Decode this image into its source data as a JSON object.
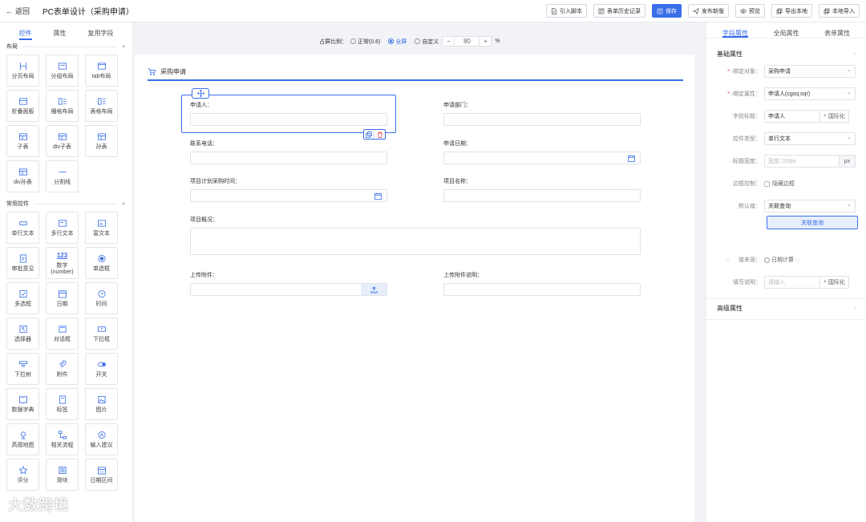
{
  "topbar": {
    "back_label": "返回",
    "title": "PC表单设计（采购申请）",
    "buttons": [
      {
        "label": "引入脚本",
        "icon": "script-icon",
        "primary": false
      },
      {
        "label": "表单历史记录",
        "icon": "history-icon",
        "primary": false
      },
      {
        "label": "保存",
        "icon": "save-icon",
        "primary": true
      },
      {
        "label": "发布新版",
        "icon": "send-icon",
        "primary": false
      },
      {
        "label": "预览",
        "icon": "eye-icon",
        "primary": false
      },
      {
        "label": "导出本地",
        "icon": "export-icon",
        "primary": false
      },
      {
        "label": "本地导入",
        "icon": "import-icon",
        "primary": false
      }
    ]
  },
  "left_panel": {
    "tabs": [
      "控件",
      "属性",
      "复用字段"
    ],
    "active_tab": 0,
    "layout_section": {
      "title": "布局",
      "items": [
        {
          "label": "分页布局",
          "icon": "page-layout-icon"
        },
        {
          "label": "分组布局",
          "icon": "tab-group-icon"
        },
        {
          "label": "tab布局",
          "icon": "tab-layout-icon"
        },
        {
          "label": "折叠面板",
          "icon": "collapse-icon"
        },
        {
          "label": "栅格布局",
          "icon": "grid-layout-icon"
        },
        {
          "label": "表格布局",
          "icon": "table-layout-icon"
        },
        {
          "label": "子表",
          "icon": "subtable-icon"
        },
        {
          "label": "div子表",
          "icon": "div-subtable-icon"
        },
        {
          "label": "孙表",
          "icon": "grandchild-table-icon"
        },
        {
          "label": "div孙表",
          "icon": "div-grandchild-icon"
        },
        {
          "label": "分割线",
          "icon": "divider-icon"
        }
      ]
    },
    "common_section": {
      "title": "常用控件",
      "items": [
        {
          "label": "单行文本",
          "icon": "single-line-icon"
        },
        {
          "label": "多行文本",
          "icon": "multi-line-icon"
        },
        {
          "label": "富文本",
          "icon": "rich-text-icon"
        },
        {
          "label": "审批意见",
          "icon": "approval-icon"
        },
        {
          "label": "数字\n(number)",
          "icon": "number-icon",
          "glyph": "123"
        },
        {
          "label": "单选框",
          "icon": "radio-icon"
        },
        {
          "label": "多选框",
          "icon": "checkbox-icon"
        },
        {
          "label": "日期",
          "icon": "calendar-icon"
        },
        {
          "label": "时间",
          "icon": "clock-icon"
        },
        {
          "label": "选择器",
          "icon": "selector-icon"
        },
        {
          "label": "对话框",
          "icon": "dialog-icon"
        },
        {
          "label": "下拉框",
          "icon": "dropdown-icon"
        },
        {
          "label": "下拉树",
          "icon": "dropdown-tree-icon"
        },
        {
          "label": "附件",
          "icon": "attachment-icon"
        },
        {
          "label": "开关",
          "icon": "switch-icon"
        },
        {
          "label": "数据字典",
          "icon": "dictionary-icon"
        },
        {
          "label": "标签",
          "icon": "tag-icon"
        },
        {
          "label": "图片",
          "icon": "image-icon"
        },
        {
          "label": "高德地图",
          "icon": "map-icon"
        },
        {
          "label": "相关流程",
          "icon": "flow-icon"
        },
        {
          "label": "输入建议",
          "icon": "suggest-icon"
        },
        {
          "label": "评分",
          "icon": "star-icon"
        },
        {
          "label": "滑块",
          "icon": "slider-icon"
        },
        {
          "label": "日期区间",
          "icon": "date-range-icon"
        }
      ]
    }
  },
  "ratio_bar": {
    "label": "占屏比例：",
    "options": [
      "正常(0.6)",
      "全屏",
      "自定义"
    ],
    "selected": 1,
    "value": "80",
    "minus": "−",
    "plus": "+",
    "unit": "%"
  },
  "form": {
    "title": "采购申请",
    "fields": {
      "applicant": "申请人：",
      "department": "申请部门：",
      "phone": "联系电话：",
      "apply_date": "申请日期：",
      "plan_time": "项目计划采购时间：",
      "project_name": "项目名称：",
      "overview": "项目概况：",
      "attachment": "上传附件：",
      "attachment_desc": "上传附件说明："
    }
  },
  "right_panel": {
    "tabs": [
      "字段属性",
      "全局属性",
      "表单属性"
    ],
    "active_tab": 0,
    "basic_title": "基础属性",
    "props": {
      "bind_object_label": "绑定对象：",
      "bind_object_value": "采购申请",
      "bind_attr_label": "绑定属性：",
      "bind_attr_value": "申请人(cgsq.sqr)",
      "field_title_label": "字段标题：",
      "field_title_value": "申请人",
      "intl_label": "国际化",
      "control_type_label": "控件类型：",
      "control_type_value": "单行文本",
      "title_width_label": "标题宽度：",
      "title_width_placeholder": "宽度:100px",
      "title_width_unit": "px",
      "border_label": "边框控制：",
      "border_value": "隐藏边框",
      "default_label": "默认值：",
      "default_value": "关联查询",
      "link_query_btn": "关联查询",
      "value_source_label": "值来源：",
      "value_source_value": "日期计算",
      "fill_desc_label": "填写说明：",
      "fill_desc_placeholder": "请输入",
      "intl_label_2": "国际化"
    },
    "advanced_title": "高级属性"
  },
  "watermark": "大数跨境",
  "colors": {
    "accent": "#3a6ee8",
    "danger": "#e04040"
  }
}
